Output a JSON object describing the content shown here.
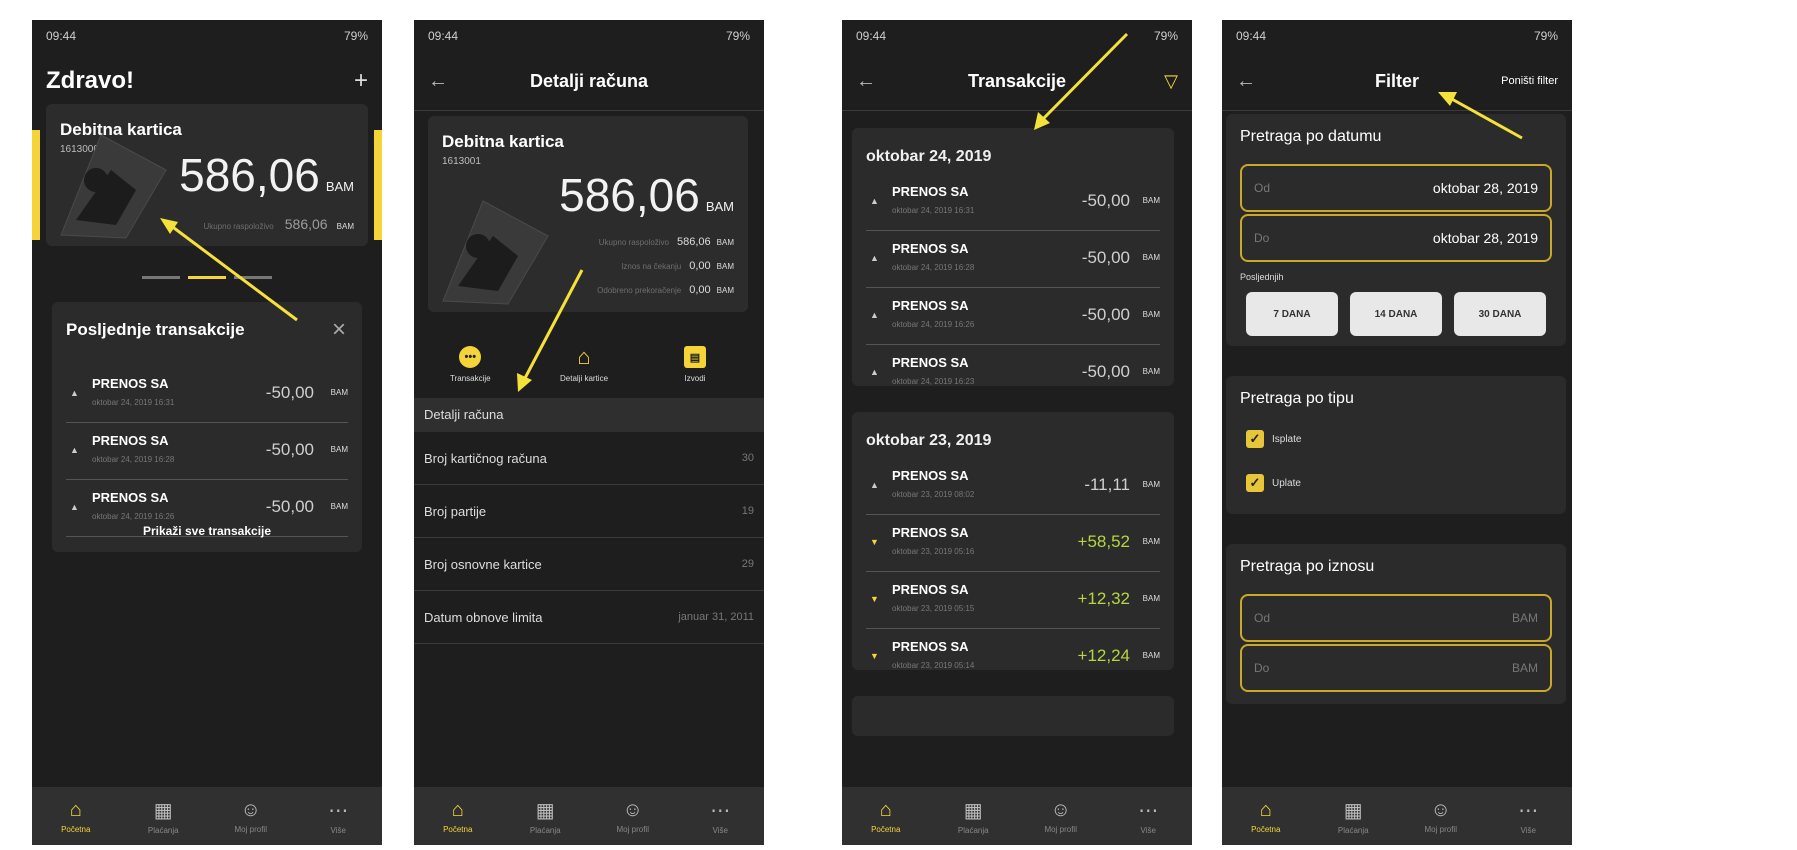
{
  "status": {
    "time": "09:44",
    "battery": "79%"
  },
  "screen1": {
    "title": "Zdravo!",
    "plus": "+",
    "card": {
      "name": "Debitna kartica",
      "number": "1613000",
      "amount": "586,06",
      "currency": "BAM",
      "sub_label": "Ukupno raspoloživo",
      "sub_value": "586,06",
      "sub_currency": "BAM"
    },
    "panel_title": "Posljednje transakcije",
    "close": "×",
    "transactions": [
      {
        "title": "PRENOS SA",
        "date": "oktobar 24, 2019 16:31",
        "value": "-50,00",
        "currency": "BAM"
      },
      {
        "title": "PRENOS SA",
        "date": "oktobar 24, 2019 16:28",
        "value": "-50,00",
        "currency": "BAM"
      },
      {
        "title": "PRENOS SA",
        "date": "oktobar 24, 2019 16:26",
        "value": "-50,00",
        "currency": "BAM"
      }
    ],
    "show_all": "Prikaži sve transakcije"
  },
  "screen2": {
    "title": "Detalji računa",
    "card": {
      "name": "Debitna kartica",
      "number": "1613001",
      "amount": "586,06",
      "currency": "BAM",
      "rows": [
        {
          "label": "Ukupno raspoloživo",
          "value": "586,06",
          "currency": "BAM"
        },
        {
          "label": "Iznos na čekanju",
          "value": "0,00",
          "currency": "BAM"
        },
        {
          "label": "Odobreno prekoračenje",
          "value": "0,00",
          "currency": "BAM"
        }
      ]
    },
    "actions": [
      {
        "label": "Transakcije",
        "icon": "•••"
      },
      {
        "label": "Detalji kartice",
        "icon": "⌂"
      },
      {
        "label": "Izvodi",
        "icon": "▤"
      }
    ],
    "section": "Detalji računa",
    "rows": [
      {
        "label": "Broj kartičnog računa",
        "value": "30"
      },
      {
        "label": "Broj partije",
        "value": "19"
      },
      {
        "label": "Broj osnovne kartice",
        "value": "29"
      },
      {
        "label": "Datum obnove limita",
        "value": "januar 31, 2011"
      }
    ]
  },
  "screen3": {
    "title": "Transakcije",
    "groups": [
      {
        "date": "oktobar 24, 2019",
        "items": [
          {
            "title": "PRENOS SA",
            "date": "oktobar 24, 2019 16:31",
            "value": "-50,00",
            "currency": "BAM",
            "dir": "out"
          },
          {
            "title": "PRENOS SA",
            "date": "oktobar 24, 2019 16:28",
            "value": "-50,00",
            "currency": "BAM",
            "dir": "out"
          },
          {
            "title": "PRENOS SA",
            "date": "oktobar 24, 2019 16:26",
            "value": "-50,00",
            "currency": "BAM",
            "dir": "out"
          },
          {
            "title": "PRENOS SA",
            "date": "oktobar 24, 2019 16:23",
            "value": "-50,00",
            "currency": "BAM",
            "dir": "out"
          }
        ]
      },
      {
        "date": "oktobar 23, 2019",
        "items": [
          {
            "title": "PRENOS SA",
            "date": "oktobar 23, 2019 08:02",
            "value": "-11,11",
            "currency": "BAM",
            "dir": "out"
          },
          {
            "title": "PRENOS SA",
            "date": "oktobar 23, 2019 05:16",
            "value": "+58,52",
            "currency": "BAM",
            "dir": "in"
          },
          {
            "title": "PRENOS SA",
            "date": "oktobar 23, 2019 05:15",
            "value": "+12,32",
            "currency": "BAM",
            "dir": "in"
          },
          {
            "title": "PRENOS SA",
            "date": "oktobar 23, 2019 05:14",
            "value": "+12,24",
            "currency": "BAM",
            "dir": "in"
          }
        ]
      }
    ]
  },
  "screen4": {
    "title": "Filter",
    "reset": "Poništi filter",
    "date_section": "Pretraga po datumu",
    "from_label": "Od",
    "from_value": "oktobar 28, 2019",
    "to_label": "Do",
    "to_value": "oktobar 28, 2019",
    "last_label": "Posljednjih",
    "chips": [
      "7 DANA",
      "14 DANA",
      "30 DANA"
    ],
    "type_section": "Pretraga po tipu",
    "types": [
      "Isplate",
      "Uplate"
    ],
    "amount_section": "Pretraga po iznosu",
    "amount_from": "Od",
    "amount_to": "Do",
    "amount_currency": "BAM"
  },
  "navbar": {
    "items": [
      "Početna",
      "Plaćanja",
      "Moj profil",
      "Više"
    ]
  },
  "colors": {
    "accent": "#f4d438",
    "background": "#1e1e1e",
    "positive": "#b5d640"
  }
}
